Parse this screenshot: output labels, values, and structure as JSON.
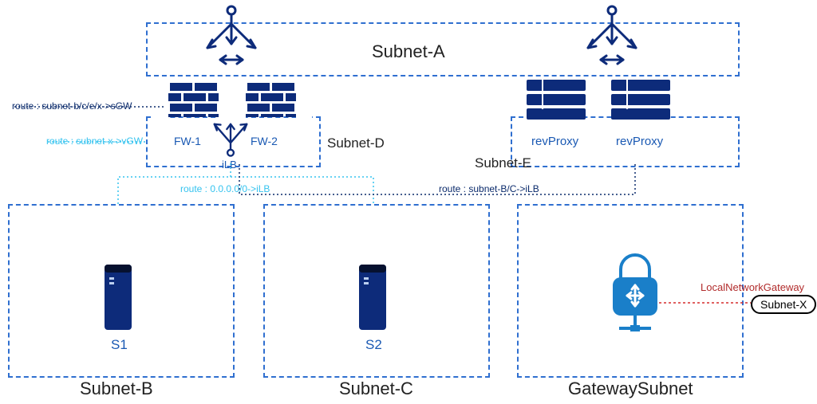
{
  "subnets": {
    "a": "Subnet-A",
    "b": "Subnet-B",
    "c": "Subnet-C",
    "d": "Subnet-D",
    "e": "Subnet-E",
    "gw": "GatewaySubnet"
  },
  "nodes": {
    "fw1": "FW-1",
    "fw2": "FW-2",
    "ilb": "iLB",
    "rev1": "revProxy",
    "rev2": "revProxy",
    "s1": "S1",
    "s2": "S2",
    "subnetx": "Subnet-X"
  },
  "routes": {
    "r1": "route : subnet-b/c/e/x->sGW",
    "r2": "route : subnet-x->vGW",
    "r3": "route : 0.0.0.0/0->iLB",
    "r4": "route : subnet-B/C->iLB"
  },
  "labels": {
    "lng": "LocalNetworkGateway"
  }
}
